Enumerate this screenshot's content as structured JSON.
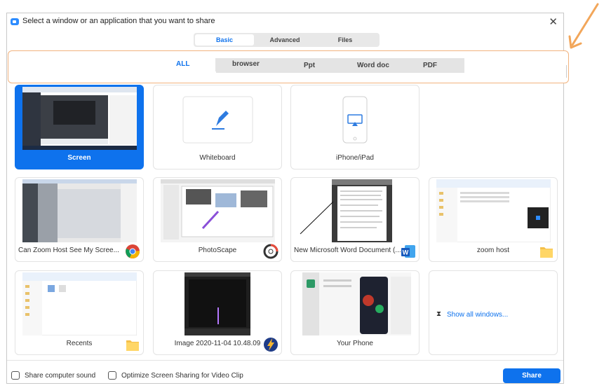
{
  "dialog": {
    "title": "Select a window or an application that you want to share",
    "close_glyph": "✕"
  },
  "tabs": [
    {
      "label": "Basic",
      "active": true
    },
    {
      "label": "Advanced",
      "active": false
    },
    {
      "label": "Files",
      "active": false
    }
  ],
  "filters": [
    {
      "label": "ALL",
      "active": true
    },
    {
      "label": "browser",
      "active": false
    },
    {
      "label": "Ppt",
      "active": false
    },
    {
      "label": "Word doc",
      "active": false
    },
    {
      "label": "PDF",
      "active": false
    }
  ],
  "items": [
    {
      "label": "Screen",
      "selected": true,
      "icon": "screen-thumbnail"
    },
    {
      "label": "Whiteboard",
      "icon": "pen-icon"
    },
    {
      "label": "iPhone/iPad",
      "icon": "iphone-airplay-icon"
    },
    {
      "label": "Can Zoom Host See My Scree...",
      "icon": "chrome-icon"
    },
    {
      "label": "PhotoScape",
      "icon": "photoscape-icon"
    },
    {
      "label": "New Microsoft Word Document (...",
      "icon": "word-icon"
    },
    {
      "label": "zoom host",
      "icon": "folder-icon"
    },
    {
      "label": "Recents",
      "icon": "folder-icon"
    },
    {
      "label": "Image 2020-11-04 10.48.09",
      "icon": "lightning-app-icon"
    },
    {
      "label": "Your Phone",
      "icon": "phone-thumbnail"
    },
    {
      "label": "Show all windows...",
      "icon": "show-all-icon"
    }
  ],
  "bottom": {
    "sound_label": "Share computer sound",
    "optimize_label": "Optimize Screen Sharing for Video Clip",
    "share_label": "Share"
  },
  "colors": {
    "accent": "#0e72ed",
    "highlight_border": "#f2b37e"
  }
}
